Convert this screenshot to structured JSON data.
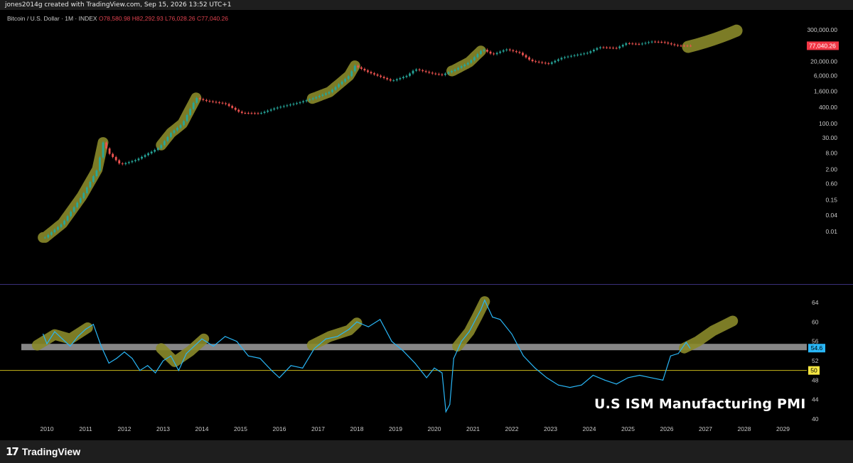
{
  "header": {
    "caption": "jones2014g created with TradingView.com, Sep 15, 2026 13:52 UTC+1"
  },
  "legend": {
    "symbol": "Bitcoin / U.S. Dollar · 1M · INDEX",
    "open": "O78,580.98",
    "high": "H82,292.93",
    "low": "L76,028.26",
    "close": "C77,040.26"
  },
  "footer": {
    "brand": "TradingView",
    "logo_mark": "17"
  },
  "pmi_title": "U.S ISM Manufacturing PMI",
  "colors": {
    "up": "#26a69a",
    "down": "#ef5350",
    "pmi_line": "#29b6f6",
    "highlight": "#8a8a2a",
    "band": "#9e9e9e",
    "fifty_line": "#c9b81a",
    "price_tag": "#f23645",
    "pmi_tag": "#29b6f6",
    "fifty_tag": "#f5e642"
  },
  "chart_data": [
    {
      "type": "line",
      "subtype": "candlestick-log",
      "series_name": "Bitcoin / U.S. Dollar",
      "scale": "log",
      "y_ticks": [
        "300,000.00",
        "20,000.00",
        "6,000.00",
        "1,600.00",
        "400.00",
        "100.00",
        "30.00",
        "8.00",
        "2.00",
        "0.60",
        "0.15",
        "0.04",
        "0.01"
      ],
      "y_tick_values": [
        300000,
        20000,
        6000,
        1600,
        400,
        100,
        30,
        8,
        2,
        0.6,
        0.15,
        0.04,
        0.01
      ],
      "last_price_label": "77,040.26",
      "last_price": 77040.26,
      "x_ticks": [
        "2010",
        "2011",
        "2012",
        "2013",
        "2014",
        "2015",
        "2016",
        "2017",
        "2018",
        "2019",
        "2020",
        "2021",
        "2022",
        "2023",
        "2024",
        "2025",
        "2026",
        "2027",
        "2028",
        "2029"
      ],
      "anchors": [
        [
          2009.95,
          0.006
        ],
        [
          2010.4,
          0.02
        ],
        [
          2010.9,
          0.2
        ],
        [
          2011.3,
          2
        ],
        [
          2011.45,
          20
        ],
        [
          2011.6,
          8
        ],
        [
          2011.9,
          3
        ],
        [
          2012.3,
          4.5
        ],
        [
          2012.9,
          13
        ],
        [
          2013.2,
          45
        ],
        [
          2013.5,
          100
        ],
        [
          2013.85,
          900
        ],
        [
          2014.1,
          700
        ],
        [
          2014.6,
          550
        ],
        [
          2015.0,
          250
        ],
        [
          2015.5,
          240
        ],
        [
          2015.9,
          380
        ],
        [
          2016.5,
          600
        ],
        [
          2016.9,
          900
        ],
        [
          2017.3,
          1500
        ],
        [
          2017.8,
          6000
        ],
        [
          2017.95,
          14000
        ],
        [
          2018.3,
          8000
        ],
        [
          2018.9,
          3800
        ],
        [
          2019.3,
          6000
        ],
        [
          2019.5,
          10500
        ],
        [
          2019.95,
          7200
        ],
        [
          2020.2,
          6400
        ],
        [
          2020.5,
          9500
        ],
        [
          2020.9,
          19000
        ],
        [
          2021.25,
          58000
        ],
        [
          2021.5,
          36000
        ],
        [
          2021.85,
          57000
        ],
        [
          2022.2,
          42000
        ],
        [
          2022.5,
          21000
        ],
        [
          2022.95,
          16500
        ],
        [
          2023.3,
          28000
        ],
        [
          2023.95,
          42000
        ],
        [
          2024.25,
          68000
        ],
        [
          2024.7,
          63000
        ],
        [
          2024.95,
          95000
        ],
        [
          2025.3,
          88000
        ],
        [
          2025.6,
          110000
        ],
        [
          2025.9,
          105000
        ],
        [
          2026.25,
          78000
        ],
        [
          2026.6,
          77040
        ]
      ]
    },
    {
      "type": "line",
      "series_name": "U.S ISM Manufacturing PMI",
      "y_ticks": [
        "64",
        "60",
        "56",
        "52",
        "48",
        "44",
        "40"
      ],
      "y_tick_values": [
        64,
        60,
        56,
        52,
        48,
        44,
        40
      ],
      "ylim": [
        40,
        65
      ],
      "current_value_label": "54.6",
      "current_value": 54.6,
      "reference_label": "50",
      "reference_value": 50,
      "band": [
        54.1,
        54.9
      ],
      "x_ticks": [
        "2010",
        "2011",
        "2012",
        "2013",
        "2014",
        "2015",
        "2016",
        "2017",
        "2018",
        "2019",
        "2020",
        "2021",
        "2022",
        "2023",
        "2024",
        "2025",
        "2026",
        "2027",
        "2028",
        "2029"
      ],
      "x": [
        2009.9,
        2010.0,
        2010.2,
        2010.4,
        2010.6,
        2010.8,
        2011.0,
        2011.2,
        2011.4,
        2011.6,
        2011.8,
        2012.0,
        2012.2,
        2012.4,
        2012.6,
        2012.8,
        2013.0,
        2013.2,
        2013.4,
        2013.6,
        2013.8,
        2014.0,
        2014.3,
        2014.6,
        2014.9,
        2015.2,
        2015.5,
        2015.8,
        2016.0,
        2016.3,
        2016.6,
        2016.9,
        2017.2,
        2017.5,
        2017.8,
        2018.0,
        2018.3,
        2018.6,
        2018.9,
        2019.2,
        2019.5,
        2019.8,
        2020.0,
        2020.2,
        2020.3,
        2020.4,
        2020.5,
        2020.7,
        2020.9,
        2021.1,
        2021.2,
        2021.3,
        2021.5,
        2021.7,
        2022.0,
        2022.3,
        2022.6,
        2022.9,
        2023.2,
        2023.5,
        2023.8,
        2024.1,
        2024.4,
        2024.7,
        2025.0,
        2025.3,
        2025.6,
        2025.9,
        2026.1,
        2026.3,
        2026.5,
        2026.6
      ],
      "y": [
        57.5,
        55.5,
        58.0,
        56.5,
        55.0,
        57.0,
        58.5,
        59.5,
        55.0,
        51.5,
        52.5,
        53.8,
        52.5,
        50.0,
        51.0,
        49.5,
        52.0,
        53.0,
        50.0,
        53.5,
        55.0,
        56.5,
        55.0,
        57.0,
        56.0,
        53.0,
        52.5,
        50.0,
        48.5,
        51.0,
        50.5,
        54.5,
        56.5,
        57.0,
        58.5,
        60.0,
        59.0,
        60.5,
        56.0,
        54.0,
        51.5,
        48.5,
        50.5,
        49.5,
        41.5,
        43.0,
        52.5,
        56.0,
        58.0,
        61.0,
        62.5,
        64.5,
        61.0,
        60.5,
        57.5,
        53.0,
        50.5,
        48.5,
        47.0,
        46.5,
        47.0,
        49.0,
        48.0,
        47.2,
        48.5,
        49.0,
        48.5,
        48.0,
        53.0,
        53.5,
        55.8,
        54.6
      ]
    }
  ]
}
